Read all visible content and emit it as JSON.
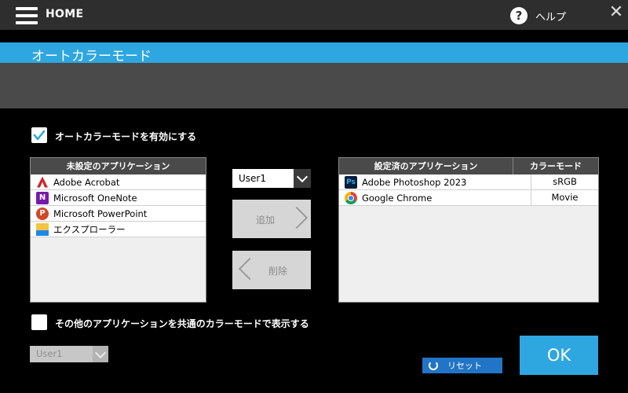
{
  "topbar": {
    "home_label": "HOME",
    "help_label": "ヘルプ",
    "help_icon": "?",
    "close_icon": "✕"
  },
  "title": "オートカラーモード",
  "enable_checkbox": {
    "label": "オートカラーモードを有効にする",
    "checked": true
  },
  "unset_apps": {
    "header": "未設定のアプリケーション",
    "items": [
      {
        "icon": "adobe-acrobat-icon",
        "label": "Adobe Acrobat"
      },
      {
        "icon": "onenote-icon",
        "label": "Microsoft OneNote"
      },
      {
        "icon": "powerpoint-icon",
        "label": "Microsoft PowerPoint"
      },
      {
        "icon": "file-explorer-icon",
        "label": "エクスプローラー"
      }
    ]
  },
  "middle": {
    "user_select": "User1",
    "add_label": "追加",
    "delete_label": "削除"
  },
  "set_apps": {
    "header_app": "設定済のアプリケーション",
    "header_mode": "カラーモード",
    "items": [
      {
        "icon": "photoshop-icon",
        "label": "Adobe Photoshop 2023",
        "mode": "sRGB"
      },
      {
        "icon": "chrome-icon",
        "label": "Google Chrome",
        "mode": "Movie"
      }
    ]
  },
  "shared_checkbox": {
    "label": "その他のアプリケーションを共通のカラーモードで表示する",
    "checked": false
  },
  "shared_select": "User1",
  "reset_label": "リセット",
  "ok_label": "OK",
  "colors": {
    "accent": "#2ea7e0",
    "reset_blue": "#2274c6",
    "topbar": "#2e2e2e"
  }
}
